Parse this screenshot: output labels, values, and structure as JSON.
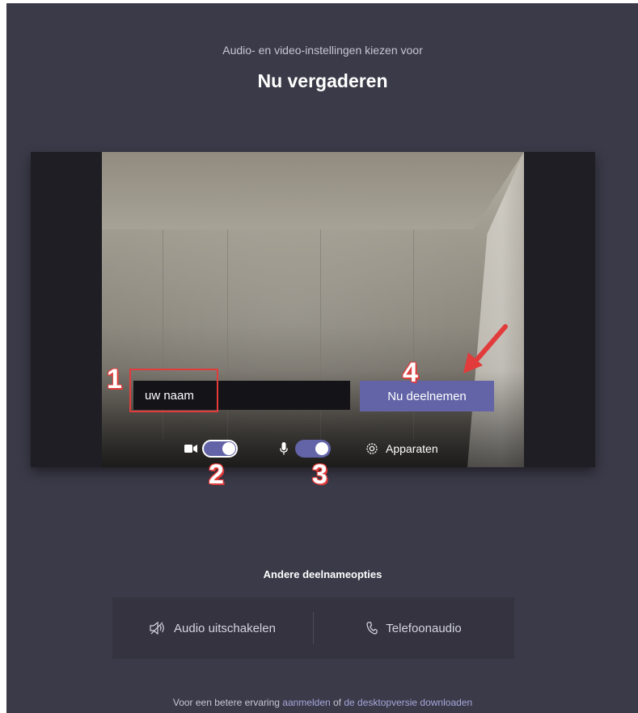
{
  "header": {
    "subtitle": "Audio- en video-instellingen kiezen voor",
    "title": "Nu vergaderen"
  },
  "preview": {
    "name_input_value": "uw naam",
    "join_button_label": "Nu deelnemen",
    "camera_toggle_on": true,
    "mic_toggle_on": true,
    "devices_label": "Apparaten"
  },
  "annotations": {
    "one": "1",
    "two": "2",
    "three": "3",
    "four": "4",
    "color": "#e23b3b"
  },
  "other_options": {
    "title": "Andere deelnameopties",
    "audio_off_label": "Audio uitschakelen",
    "phone_audio_label": "Telefoonaudio"
  },
  "footer": {
    "prefix": "Voor een betere ervaring ",
    "sign_in_link": "aanmelden",
    "middle": " of ",
    "download_link": "de desktopversie downloaden"
  },
  "colors": {
    "background": "#3b3a48",
    "accent": "#6264a7",
    "link": "#a6a7dc"
  },
  "icons": [
    "camera-icon",
    "microphone-icon",
    "gear-icon",
    "speaker-muted-icon",
    "phone-icon",
    "arrow-icon"
  ]
}
